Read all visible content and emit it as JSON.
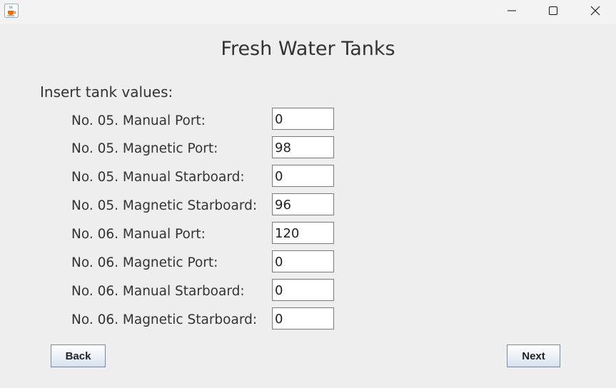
{
  "titlebar": {
    "icons": {
      "app": "java-cup-icon",
      "minimize": "minimize-icon",
      "maximize": "maximize-icon",
      "close": "close-icon"
    }
  },
  "heading": "Fresh Water Tanks",
  "insert_label": "Insert tank values:",
  "tanks": [
    {
      "label": "No. 05. Manual Port:",
      "value": "0"
    },
    {
      "label": "No. 05. Magnetic Port:",
      "value": "98"
    },
    {
      "label": "No. 05. Manual Starboard:",
      "value": "0"
    },
    {
      "label": "No. 05. Magnetic Starboard:",
      "value": "96"
    },
    {
      "label": "No. 06. Manual Port:",
      "value": "120"
    },
    {
      "label": "No. 06. Magnetic Port:",
      "value": "0"
    },
    {
      "label": "No. 06. Manual Starboard:",
      "value": "0"
    },
    {
      "label": "No. 06. Magnetic Starboard:",
      "value": "0"
    }
  ],
  "buttons": {
    "back": "Back",
    "next": "Next"
  },
  "colors": {
    "background": "#eeeeee",
    "titlebar": "#f3f3f3",
    "button_border": "#7a8aa0"
  }
}
